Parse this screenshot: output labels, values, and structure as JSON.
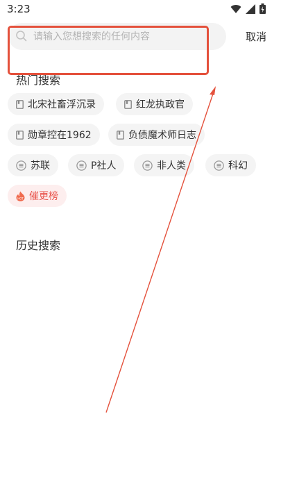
{
  "status_bar": {
    "time": "3:23",
    "icons": [
      "wifi-icon",
      "signal-icon",
      "battery-icon"
    ]
  },
  "search": {
    "placeholder": "请输入您想搜索的任何内容",
    "value": "",
    "cancel_label": "取消"
  },
  "hot_search": {
    "title": "热门搜索",
    "book_chips": [
      {
        "label": "北宋社畜浮沉录",
        "icon": "book-icon"
      },
      {
        "label": "红龙执政官",
        "icon": "book-icon"
      },
      {
        "label": "勋章控在1962",
        "icon": "book-icon"
      },
      {
        "label": "负债魔术师日志",
        "icon": "book-icon"
      }
    ],
    "tag_chips": [
      {
        "label": "苏联",
        "icon": "tag-icon"
      },
      {
        "label": "P社人",
        "icon": "tag-icon"
      },
      {
        "label": "非人类",
        "icon": "tag-icon"
      },
      {
        "label": "科幻",
        "icon": "tag-icon"
      }
    ],
    "rank_chip": {
      "label": "催更榜",
      "icon": "flame-icon"
    }
  },
  "history": {
    "title": "历史搜索"
  },
  "colors": {
    "annotation": "#e4513c",
    "hot_accent": "#e8524a",
    "chip_bg": "#f4f4f4"
  }
}
